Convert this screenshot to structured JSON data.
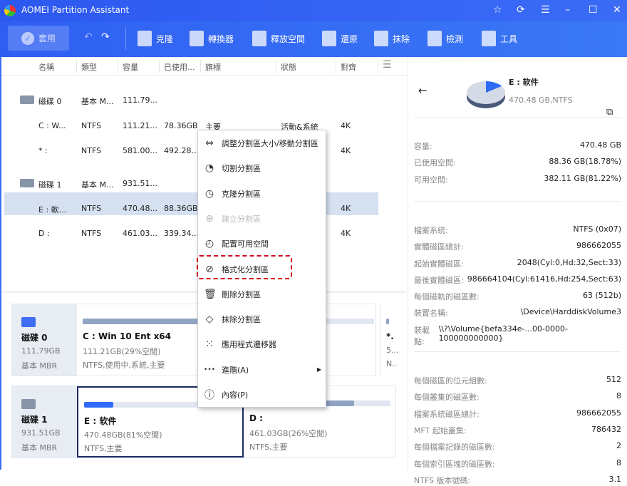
{
  "app": {
    "title": "AOMEI Partition Assistant"
  },
  "toolbar": {
    "apply": "套用",
    "items": [
      {
        "label": "克隆",
        "icon": "clone-icon"
      },
      {
        "label": "轉換器",
        "icon": "convert-icon"
      },
      {
        "label": "釋放空間",
        "icon": "free-space-icon"
      },
      {
        "label": "還原",
        "icon": "restore-icon"
      },
      {
        "label": "抹除",
        "icon": "wipe-icon"
      },
      {
        "label": "檢測",
        "icon": "check-icon"
      },
      {
        "label": "工具",
        "icon": "tools-icon"
      }
    ]
  },
  "table": {
    "columns": [
      "名稱",
      "類型",
      "容量",
      "已使用...",
      "旗標",
      "狀態",
      "對齊"
    ],
    "rows": [
      {
        "kind": "disk",
        "icon": "windows-disk-icon",
        "cells": [
          "磁碟 0",
          "基本 M...",
          "111.79...",
          "",
          "",
          "",
          ""
        ]
      },
      {
        "kind": "part",
        "cells": [
          "C : W...",
          "NTFS",
          "111.21...",
          "78.36GB",
          "主要",
          "活動&系統",
          "4K"
        ]
      },
      {
        "kind": "part",
        "cells": [
          "* :",
          "NTFS",
          "581.00...",
          "492.28...",
          "",
          "",
          "4K"
        ]
      },
      {
        "kind": "disk",
        "icon": "disk-icon",
        "cells": [
          "磁碟 1",
          "基本 M...",
          "931.51...",
          "",
          "",
          "",
          ""
        ]
      },
      {
        "kind": "part",
        "selected": true,
        "cells": [
          "E : 軟...",
          "NTFS",
          "470.48...",
          "88.36GB",
          "",
          "",
          "4K"
        ]
      },
      {
        "kind": "part",
        "cells": [
          "D :",
          "NTFS",
          "461.03...",
          "339.34...",
          "",
          "",
          "4K"
        ]
      }
    ]
  },
  "disks": [
    {
      "name": "磁碟 0",
      "size": "111.79GB",
      "type": "基本 MBR",
      "partitions": [
        {
          "title": "C : Win 10 Ent x64",
          "sub": "111.21GB(29%空閒)",
          "info": "NTFS,使用中,系統,主要",
          "used": 71
        },
        {
          "title": "*...",
          "sub": "5...",
          "info": "N..",
          "used": 100
        }
      ]
    },
    {
      "name": "磁碟 1",
      "size": "931.51GB",
      "type": "基本 MBR",
      "partitions": [
        {
          "title": "E : 软件",
          "sub": "470.48GB(81%空閒)",
          "info": "NTFS,主要",
          "used": 19
        },
        {
          "title": "D :",
          "sub": "461.03GB(26%空閒)",
          "info": "NTFS,主要",
          "used": 74
        }
      ]
    }
  ],
  "menu": [
    {
      "label": "調整分割區大小/移動分割區",
      "icon": "resize-icon",
      "glyph": "⇔"
    },
    {
      "label": "切割分割區",
      "icon": "split-icon",
      "glyph": "◔"
    },
    {
      "label": "克隆分割區",
      "icon": "clone-partition-icon",
      "glyph": "◷"
    },
    {
      "label": "建立分割區",
      "icon": "create-partition-icon",
      "glyph": "⊕",
      "disabled": true
    },
    {
      "label": "配置可用空間",
      "icon": "allocate-icon",
      "glyph": "◴"
    },
    {
      "label": "格式化分割區",
      "icon": "format-icon",
      "glyph": "⊘"
    },
    {
      "label": "刪除分割區",
      "icon": "trash-icon",
      "glyph": "🗑"
    },
    {
      "label": "抹除分割區",
      "icon": "eraser-icon",
      "glyph": "◇"
    },
    {
      "label": "應用程式遷移器",
      "icon": "app-mover-icon",
      "glyph": "⁙"
    },
    {
      "label": "進階(A)",
      "icon": "more-icon",
      "glyph": "•••",
      "submenu": true
    },
    {
      "label": "內容(P)",
      "icon": "info-icon",
      "glyph": "ⓘ"
    }
  ],
  "details": {
    "title": "E : 软件",
    "subtitle": "470.48 GB,NTFS",
    "used_percent": 18.78,
    "groups": [
      [
        [
          "容量:",
          "470.48 GB"
        ],
        [
          "已使用空間:",
          "88.36 GB(18.78%)"
        ],
        [
          "可用空間:",
          "382.11 GB(81.22%)"
        ]
      ],
      [
        [
          "檔案系統:",
          "NTFS (0x07)"
        ],
        [
          "實體磁區總計:",
          "986662055"
        ],
        [
          "起始實體磁區:",
          "2048(Cyl:0,Hd:32,Sect:33)"
        ],
        [
          "最後實體磁區:",
          "986664104(Cyl:61416,Hd:254,Sect:63)"
        ],
        [
          "每個磁軌的磁區數:",
          "63 (512b)"
        ],
        [
          "裝置名稱:",
          "\\Device\\HarddiskVolume3"
        ],
        [
          "裝載點:",
          "\\\\?\\Volume{befa334e-...00-0000-100000000000}"
        ]
      ],
      [
        [
          "每個磁區的位元組數:",
          "512"
        ],
        [
          "每個叢集的磁區數:",
          "8"
        ],
        [
          "檔案系統磁區總計:",
          "986662055"
        ],
        [
          "MFT 起始叢集:",
          "786432"
        ],
        [
          "每個檔案記錄的磁區數:",
          "2"
        ],
        [
          "每個索引區塊的磁區數:",
          "8"
        ],
        [
          "NTFS 版本號碼:",
          "3.1"
        ]
      ]
    ]
  },
  "colors": {
    "accent": "#2f5ff2",
    "used_bar": "#8fa3c2",
    "selected_used": "#2f6bf5",
    "highlight": "#d0021b"
  }
}
